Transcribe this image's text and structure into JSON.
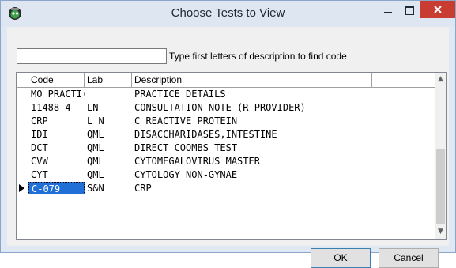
{
  "window": {
    "title": "Choose Tests to View",
    "app_icon": "ghost-app-icon",
    "controls": {
      "minimize": "minimize-icon",
      "maximize": "maximize-icon",
      "close": "close-icon"
    }
  },
  "search": {
    "value": "",
    "hint": "Type first letters of description to find code"
  },
  "grid": {
    "columns": [
      "Code",
      "Lab",
      "Description"
    ],
    "rows": [
      {
        "code": "MO PRACTI(L",
        "lab": "",
        "description": "PRACTICE DETAILS"
      },
      {
        "code": "11488-4",
        "lab": "LN",
        "description": "CONSULTATION NOTE (R PROVIDER)"
      },
      {
        "code": "CRP",
        "lab": "L N",
        "description": "C REACTIVE PROTEIN"
      },
      {
        "code": "IDI",
        "lab": "QML",
        "description": "DISACCHARIDASES,INTESTINE"
      },
      {
        "code": "DCT",
        "lab": "QML",
        "description": "DIRECT COOMBS TEST"
      },
      {
        "code": "CVW",
        "lab": "QML",
        "description": "CYTOMEGALOVIRUS MASTER"
      },
      {
        "code": "CYT",
        "lab": "QML",
        "description": "CYTOLOGY NON-GYNAE"
      },
      {
        "code": "C-079",
        "lab": "S&N",
        "description": "CRP"
      }
    ],
    "selected_index": 7
  },
  "buttons": {
    "ok": "OK",
    "cancel": "Cancel"
  },
  "colors": {
    "titlebar": "#dde6f1",
    "close": "#c83c32",
    "selection": "#1f6fd6"
  }
}
